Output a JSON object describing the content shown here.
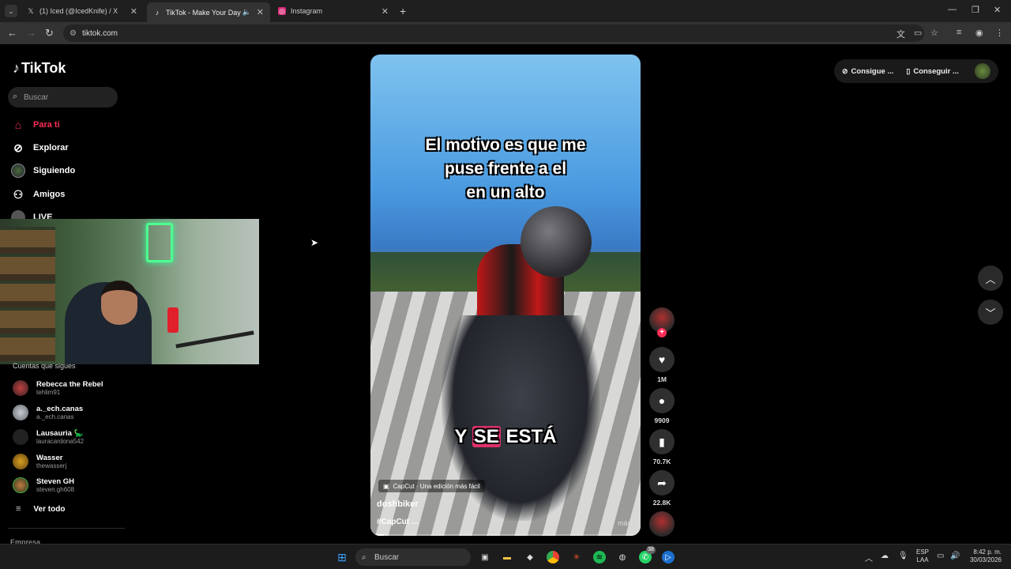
{
  "browser": {
    "tabs": [
      {
        "label": "(1) Iced (@IcedKnife) / X",
        "icon": "x-logo-icon"
      },
      {
        "label": "TikTok - Make Your Day",
        "icon": "tiktok-icon",
        "audio": true
      },
      {
        "label": "Instagram",
        "icon": "instagram-icon"
      }
    ],
    "url": "tiktok.com"
  },
  "sidebar": {
    "logo": "TikTok",
    "search_placeholder": "Buscar",
    "nav": [
      {
        "label": "Para ti",
        "icon": "home-icon",
        "active": true
      },
      {
        "label": "Explorar",
        "icon": "compass-icon"
      },
      {
        "label": "Siguiendo",
        "icon": "following-icon"
      },
      {
        "label": "Amigos",
        "icon": "friends-icon"
      },
      {
        "label": "LIVE",
        "icon": "live-icon"
      }
    ],
    "following_title": "Cuentas que sigues",
    "following": [
      {
        "name": "Rebecca the Rebel",
        "handle": "tehlim91"
      },
      {
        "name": "a._ech.canas",
        "handle": "a._ech.canas"
      },
      {
        "name": "Lausauria 🦕",
        "handle": "lauracardona542"
      },
      {
        "name": "Wasser",
        "handle": "thewasserj"
      },
      {
        "name": "Steven GH",
        "handle": "steven.gh608"
      }
    ],
    "see_all": "Ver todo",
    "footer_section": "Empresa"
  },
  "video": {
    "caption_lines": [
      "El motivo es que me",
      "puse frente a el",
      "en un alto"
    ],
    "subtitle_plain": "Y ",
    "subtitle_highlight": "SE",
    "subtitle_rest": " ESTÁ",
    "capcut_label": "CapCut · Una edición más fácil",
    "author": "doshbiker",
    "tags": "#CapCut ...",
    "more": "más",
    "progress": 0.05
  },
  "actions": {
    "likes": "1M",
    "comments": "9909",
    "saves": "70.7K",
    "shares": "22.8K"
  },
  "top_right": {
    "get_coins": "Consigue ...",
    "get_app": "Conseguir ..."
  },
  "taskbar": {
    "search_placeholder": "Buscar",
    "whatsapp_badge": "38",
    "lang_line1": "ESP",
    "lang_line2": "LAA",
    "time": "8:42 p. m.",
    "date": "30/03/2026"
  },
  "colors": {
    "accent": "#fe2c55",
    "background": "#000000"
  }
}
